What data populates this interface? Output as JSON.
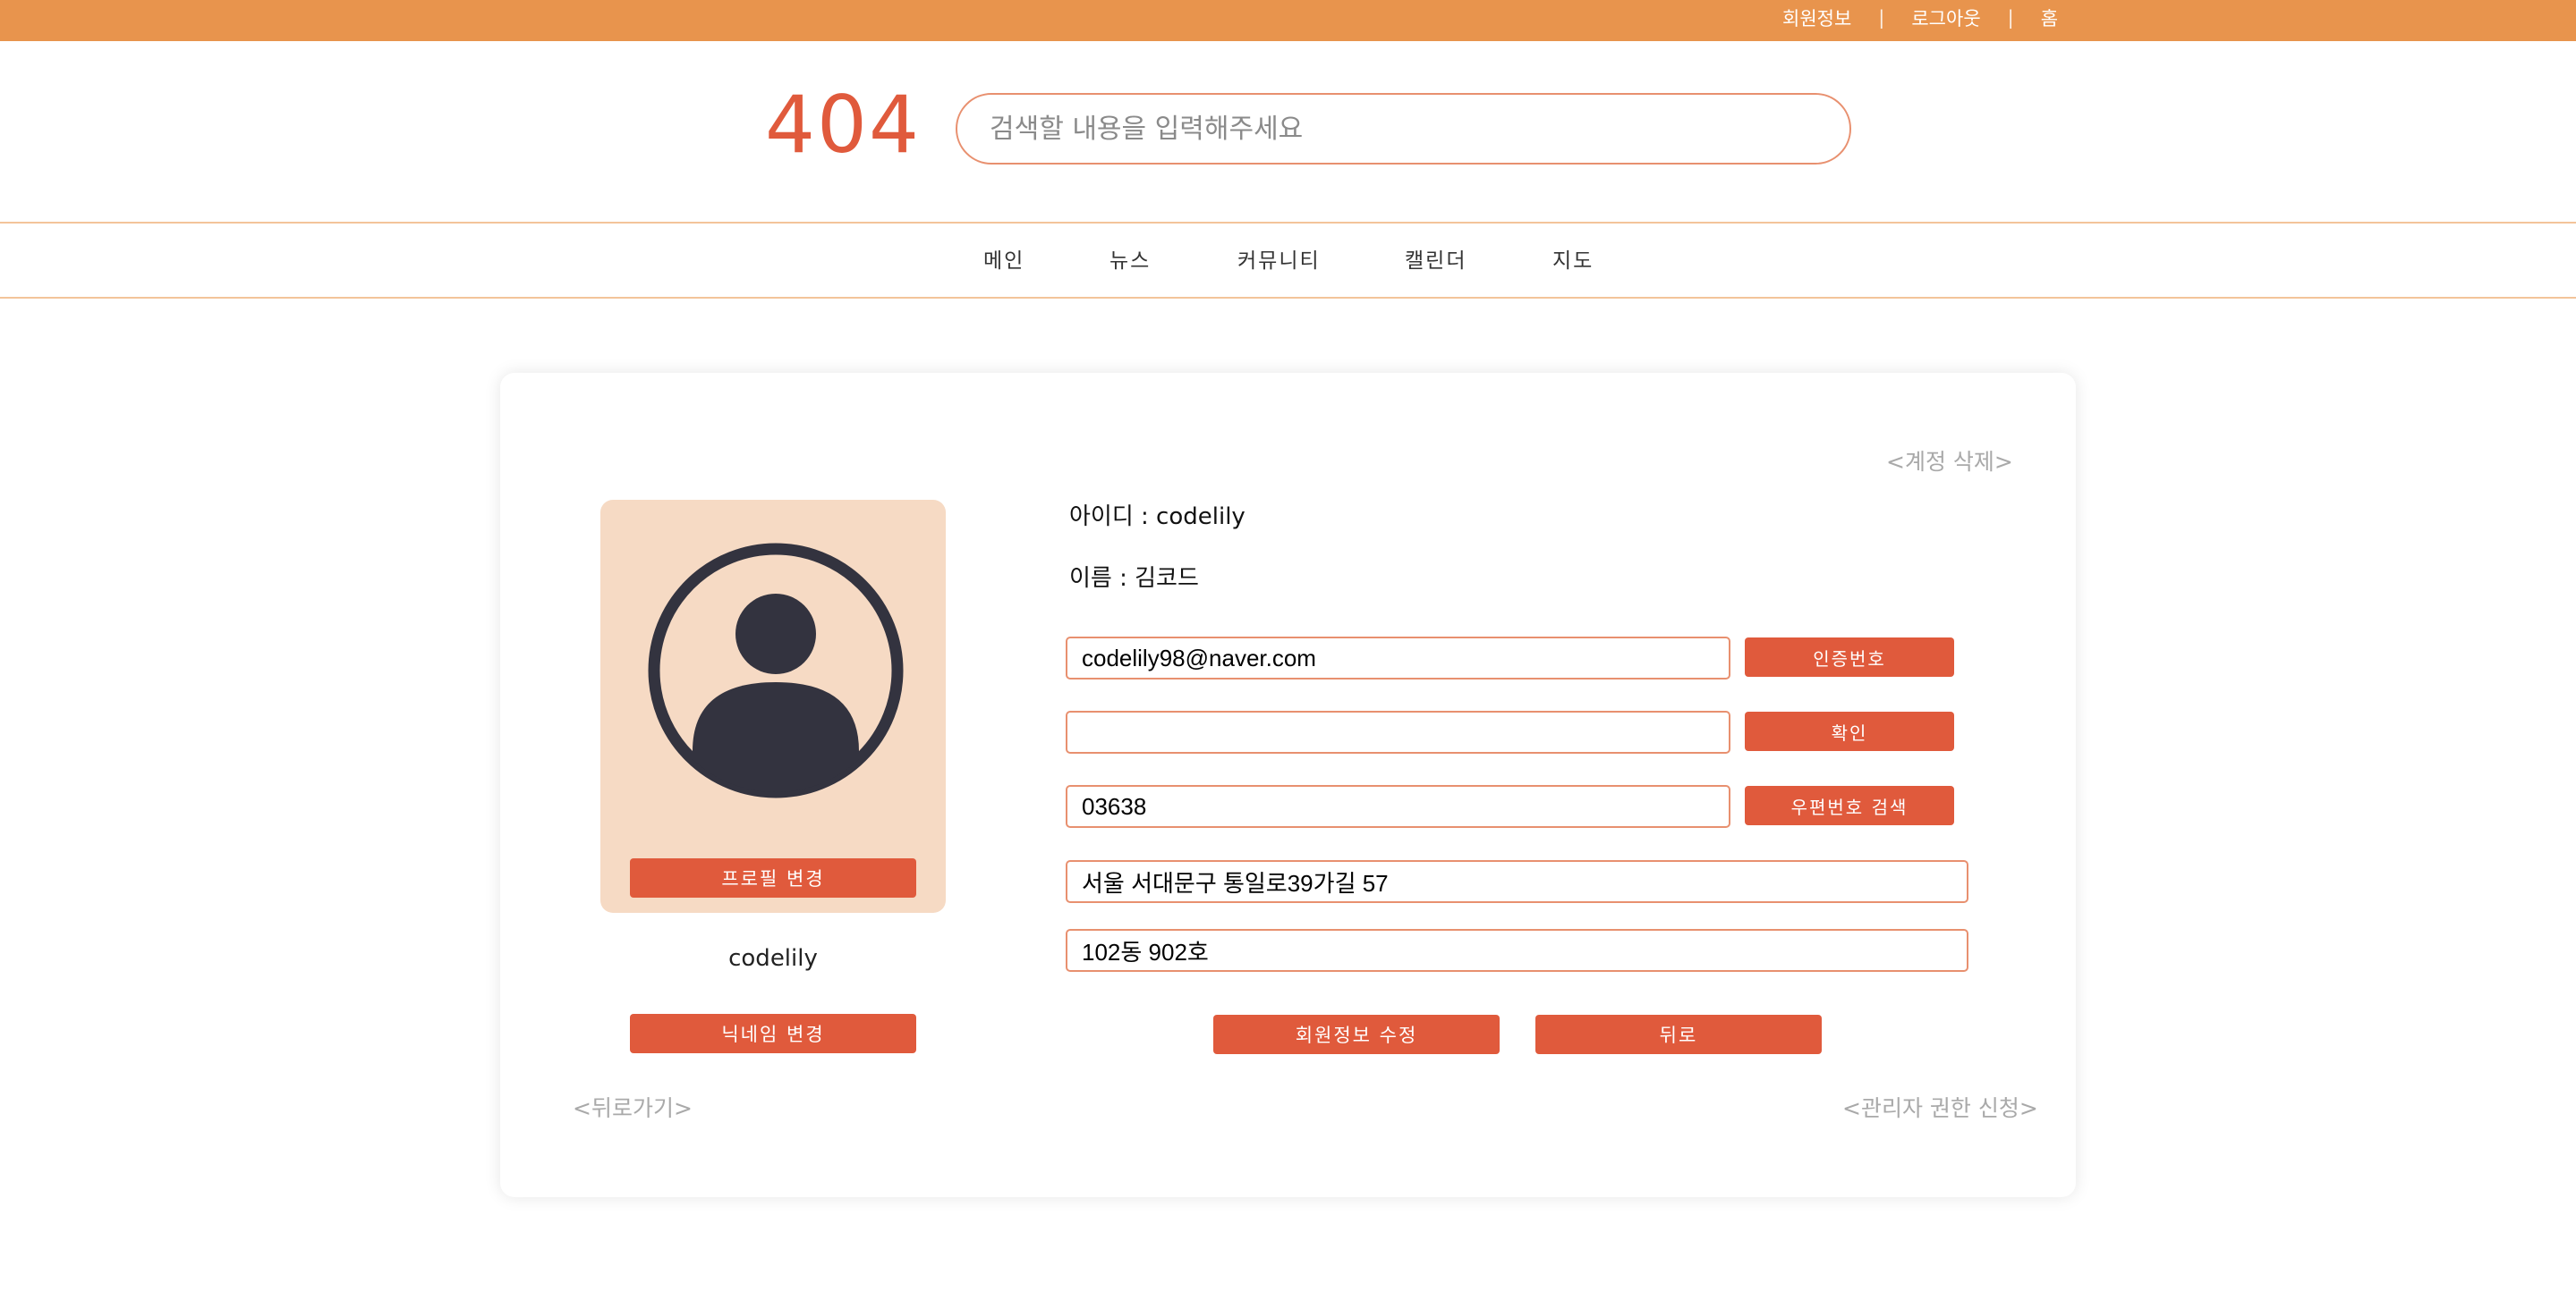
{
  "topbar": {
    "links": [
      "회원정보",
      "로그아웃",
      "홈"
    ],
    "separator": "|"
  },
  "header": {
    "logo": "404",
    "search_placeholder": "검색할 내용을 입력해주세요",
    "search_value": ""
  },
  "nav": {
    "items": [
      "메인",
      "뉴스",
      "커뮤니티",
      "캘린더",
      "지도"
    ]
  },
  "profile": {
    "delete_account": "<계정 삭제>",
    "change_profile_button": "프로필 변경",
    "nickname": "codelily",
    "change_nickname_button": "닉네임 변경",
    "back_link": "<뒤로가기>",
    "admin_request_link": "<관리자 권한 신청>",
    "user_id_label": "아이디 : codelily",
    "name_label": "이름 : 김코드",
    "email_value": "codelily98@naver.com",
    "verify_code_button": "인증번호",
    "code_value": "",
    "confirm_button": "확인",
    "postcode_value": "03638",
    "postcode_search_button": "우편번호 검색",
    "address_value": "서울 서대문구 통일로39가길 57",
    "address_detail_value": "102동 902호",
    "edit_info_button": "회원정보 수정",
    "back_button": "뒤로"
  },
  "colors": {
    "topbar": "#e8944d",
    "accent": "#e05a3c",
    "avatar_bg": "#f6dac4",
    "field_border": "#e8906f"
  }
}
